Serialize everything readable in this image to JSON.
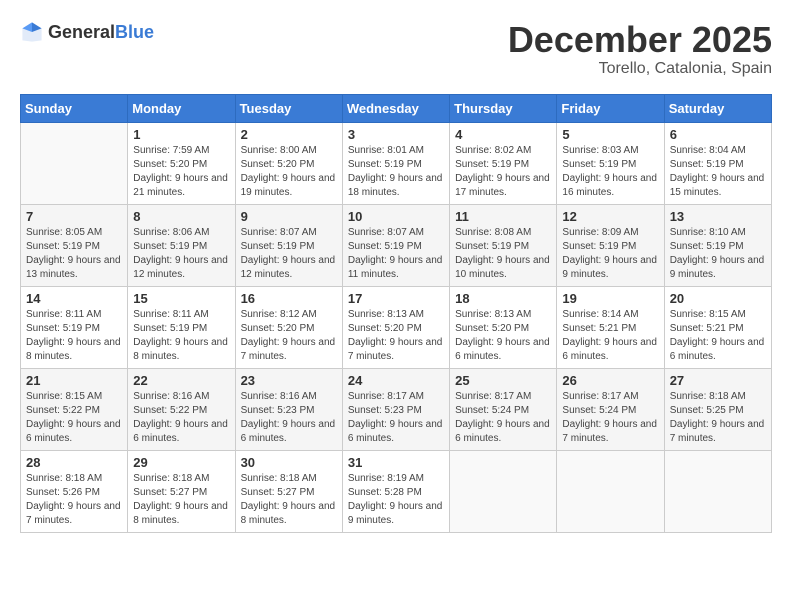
{
  "logo": {
    "text_general": "General",
    "text_blue": "Blue"
  },
  "title": {
    "month_year": "December 2025",
    "location": "Torello, Catalonia, Spain"
  },
  "days_of_week": [
    "Sunday",
    "Monday",
    "Tuesday",
    "Wednesday",
    "Thursday",
    "Friday",
    "Saturday"
  ],
  "weeks": [
    [
      {
        "day": "",
        "sunrise": "",
        "sunset": "",
        "daylight": ""
      },
      {
        "day": "1",
        "sunrise": "Sunrise: 7:59 AM",
        "sunset": "Sunset: 5:20 PM",
        "daylight": "Daylight: 9 hours and 21 minutes."
      },
      {
        "day": "2",
        "sunrise": "Sunrise: 8:00 AM",
        "sunset": "Sunset: 5:20 PM",
        "daylight": "Daylight: 9 hours and 19 minutes."
      },
      {
        "day": "3",
        "sunrise": "Sunrise: 8:01 AM",
        "sunset": "Sunset: 5:19 PM",
        "daylight": "Daylight: 9 hours and 18 minutes."
      },
      {
        "day": "4",
        "sunrise": "Sunrise: 8:02 AM",
        "sunset": "Sunset: 5:19 PM",
        "daylight": "Daylight: 9 hours and 17 minutes."
      },
      {
        "day": "5",
        "sunrise": "Sunrise: 8:03 AM",
        "sunset": "Sunset: 5:19 PM",
        "daylight": "Daylight: 9 hours and 16 minutes."
      },
      {
        "day": "6",
        "sunrise": "Sunrise: 8:04 AM",
        "sunset": "Sunset: 5:19 PM",
        "daylight": "Daylight: 9 hours and 15 minutes."
      }
    ],
    [
      {
        "day": "7",
        "sunrise": "Sunrise: 8:05 AM",
        "sunset": "Sunset: 5:19 PM",
        "daylight": "Daylight: 9 hours and 13 minutes."
      },
      {
        "day": "8",
        "sunrise": "Sunrise: 8:06 AM",
        "sunset": "Sunset: 5:19 PM",
        "daylight": "Daylight: 9 hours and 12 minutes."
      },
      {
        "day": "9",
        "sunrise": "Sunrise: 8:07 AM",
        "sunset": "Sunset: 5:19 PM",
        "daylight": "Daylight: 9 hours and 12 minutes."
      },
      {
        "day": "10",
        "sunrise": "Sunrise: 8:07 AM",
        "sunset": "Sunset: 5:19 PM",
        "daylight": "Daylight: 9 hours and 11 minutes."
      },
      {
        "day": "11",
        "sunrise": "Sunrise: 8:08 AM",
        "sunset": "Sunset: 5:19 PM",
        "daylight": "Daylight: 9 hours and 10 minutes."
      },
      {
        "day": "12",
        "sunrise": "Sunrise: 8:09 AM",
        "sunset": "Sunset: 5:19 PM",
        "daylight": "Daylight: 9 hours and 9 minutes."
      },
      {
        "day": "13",
        "sunrise": "Sunrise: 8:10 AM",
        "sunset": "Sunset: 5:19 PM",
        "daylight": "Daylight: 9 hours and 9 minutes."
      }
    ],
    [
      {
        "day": "14",
        "sunrise": "Sunrise: 8:11 AM",
        "sunset": "Sunset: 5:19 PM",
        "daylight": "Daylight: 9 hours and 8 minutes."
      },
      {
        "day": "15",
        "sunrise": "Sunrise: 8:11 AM",
        "sunset": "Sunset: 5:19 PM",
        "daylight": "Daylight: 9 hours and 8 minutes."
      },
      {
        "day": "16",
        "sunrise": "Sunrise: 8:12 AM",
        "sunset": "Sunset: 5:20 PM",
        "daylight": "Daylight: 9 hours and 7 minutes."
      },
      {
        "day": "17",
        "sunrise": "Sunrise: 8:13 AM",
        "sunset": "Sunset: 5:20 PM",
        "daylight": "Daylight: 9 hours and 7 minutes."
      },
      {
        "day": "18",
        "sunrise": "Sunrise: 8:13 AM",
        "sunset": "Sunset: 5:20 PM",
        "daylight": "Daylight: 9 hours and 6 minutes."
      },
      {
        "day": "19",
        "sunrise": "Sunrise: 8:14 AM",
        "sunset": "Sunset: 5:21 PM",
        "daylight": "Daylight: 9 hours and 6 minutes."
      },
      {
        "day": "20",
        "sunrise": "Sunrise: 8:15 AM",
        "sunset": "Sunset: 5:21 PM",
        "daylight": "Daylight: 9 hours and 6 minutes."
      }
    ],
    [
      {
        "day": "21",
        "sunrise": "Sunrise: 8:15 AM",
        "sunset": "Sunset: 5:22 PM",
        "daylight": "Daylight: 9 hours and 6 minutes."
      },
      {
        "day": "22",
        "sunrise": "Sunrise: 8:16 AM",
        "sunset": "Sunset: 5:22 PM",
        "daylight": "Daylight: 9 hours and 6 minutes."
      },
      {
        "day": "23",
        "sunrise": "Sunrise: 8:16 AM",
        "sunset": "Sunset: 5:23 PM",
        "daylight": "Daylight: 9 hours and 6 minutes."
      },
      {
        "day": "24",
        "sunrise": "Sunrise: 8:17 AM",
        "sunset": "Sunset: 5:23 PM",
        "daylight": "Daylight: 9 hours and 6 minutes."
      },
      {
        "day": "25",
        "sunrise": "Sunrise: 8:17 AM",
        "sunset": "Sunset: 5:24 PM",
        "daylight": "Daylight: 9 hours and 6 minutes."
      },
      {
        "day": "26",
        "sunrise": "Sunrise: 8:17 AM",
        "sunset": "Sunset: 5:24 PM",
        "daylight": "Daylight: 9 hours and 7 minutes."
      },
      {
        "day": "27",
        "sunrise": "Sunrise: 8:18 AM",
        "sunset": "Sunset: 5:25 PM",
        "daylight": "Daylight: 9 hours and 7 minutes."
      }
    ],
    [
      {
        "day": "28",
        "sunrise": "Sunrise: 8:18 AM",
        "sunset": "Sunset: 5:26 PM",
        "daylight": "Daylight: 9 hours and 7 minutes."
      },
      {
        "day": "29",
        "sunrise": "Sunrise: 8:18 AM",
        "sunset": "Sunset: 5:27 PM",
        "daylight": "Daylight: 9 hours and 8 minutes."
      },
      {
        "day": "30",
        "sunrise": "Sunrise: 8:18 AM",
        "sunset": "Sunset: 5:27 PM",
        "daylight": "Daylight: 9 hours and 8 minutes."
      },
      {
        "day": "31",
        "sunrise": "Sunrise: 8:19 AM",
        "sunset": "Sunset: 5:28 PM",
        "daylight": "Daylight: 9 hours and 9 minutes."
      },
      {
        "day": "",
        "sunrise": "",
        "sunset": "",
        "daylight": ""
      },
      {
        "day": "",
        "sunrise": "",
        "sunset": "",
        "daylight": ""
      },
      {
        "day": "",
        "sunrise": "",
        "sunset": "",
        "daylight": ""
      }
    ]
  ]
}
